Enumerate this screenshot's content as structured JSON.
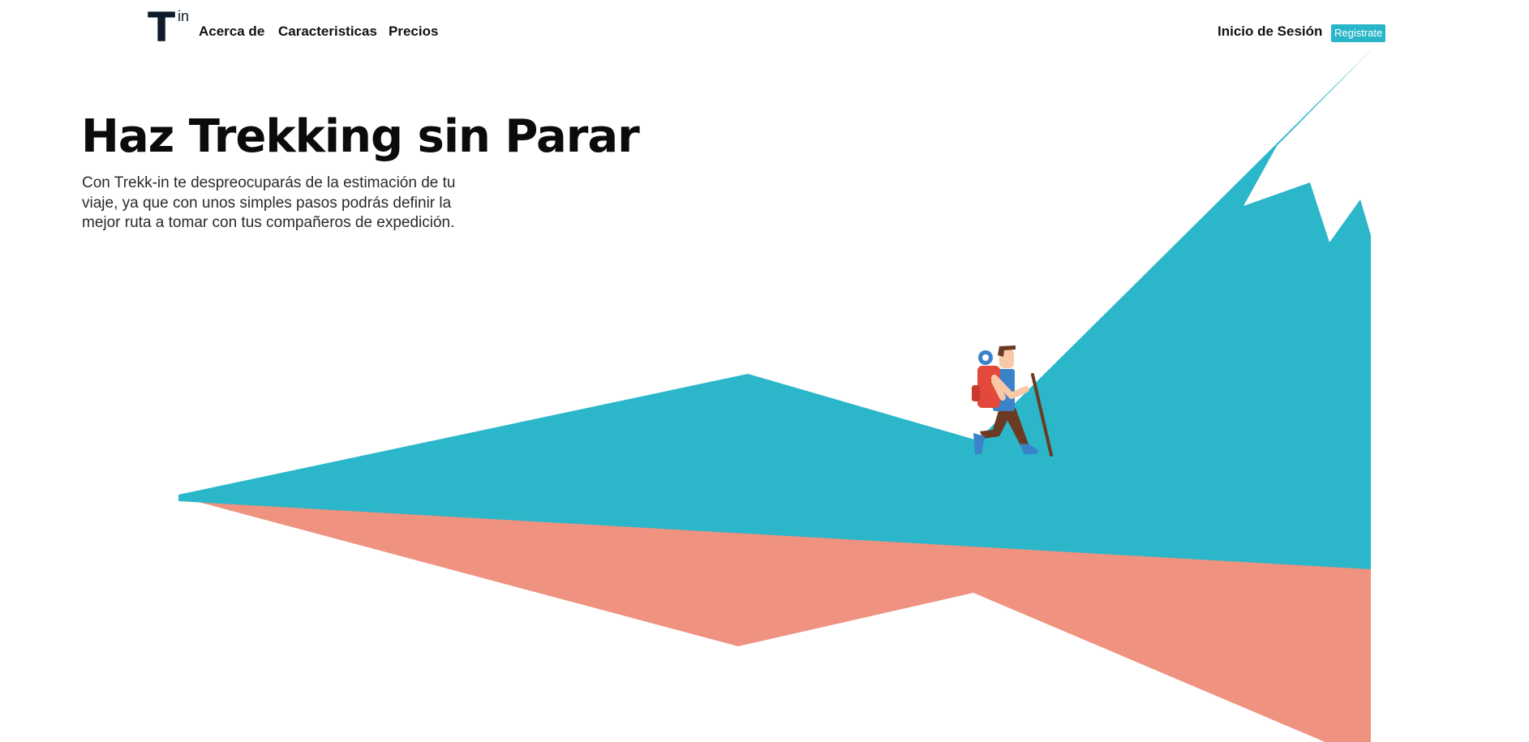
{
  "logo": {
    "main": "T",
    "sub": "in"
  },
  "nav": {
    "links": [
      "Acerca de",
      "Caracteristicas",
      "Precios"
    ],
    "login": "Inicio de Sesión",
    "register": "Registrate"
  },
  "hero": {
    "title": "Haz Trekking sin Parar",
    "description": "Con Trekk-in te despreocuparás de la estimación de tu viaje, ya que con unos simples pasos podrás definir la mejor ruta a tomar con tus compañeros de expedición."
  },
  "colors": {
    "accent": "#29b6c9",
    "mountain": "#2bb6ca",
    "ground": "#ef927f",
    "hiker_pack": "#e2483b",
    "hiker_shirt": "#3b83c9",
    "hiker_pants": "#6b3a22",
    "hiker_skin": "#f9c8a6"
  },
  "illustration": {
    "name": "hiker-mountain-illustration"
  }
}
